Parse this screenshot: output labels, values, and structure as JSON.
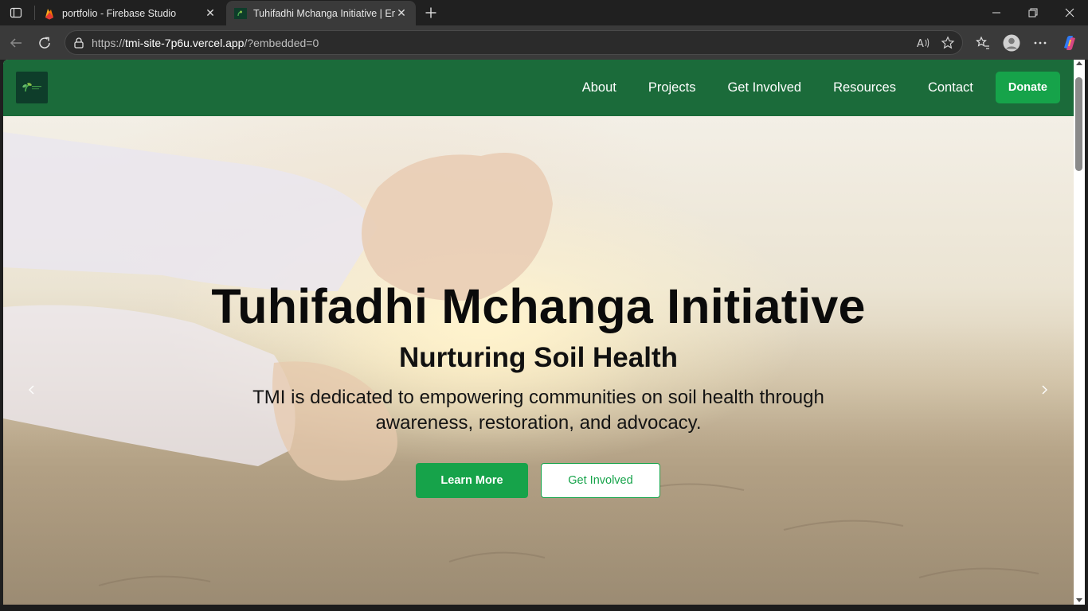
{
  "browser": {
    "tabs": [
      {
        "title": "portfolio - Firebase Studio",
        "favicon": "firebase-icon",
        "active": false
      },
      {
        "title": "Tuhifadhi Mchanga Initiative | Em",
        "favicon": "tmi-logo-icon",
        "active": true
      }
    ],
    "url": {
      "scheme": "https://",
      "host": "tmi-site-7p6u.vercel.app",
      "path": "/?embedded=0"
    }
  },
  "site": {
    "nav": {
      "items": [
        "About",
        "Projects",
        "Get Involved",
        "Resources",
        "Contact"
      ],
      "donate_label": "Donate"
    },
    "hero": {
      "title": "Tuhifadhi Mchanga Initiative",
      "subtitle": "Nurturing Soil Health",
      "description": "TMI is dedicated to empowering communities on soil health through awareness, restoration, and advocacy.",
      "primary_cta": "Learn More",
      "secondary_cta": "Get Involved"
    }
  },
  "colors": {
    "header": "#1b6b3a",
    "accent": "#16a34a",
    "logo_bg": "#0e3d2a"
  }
}
